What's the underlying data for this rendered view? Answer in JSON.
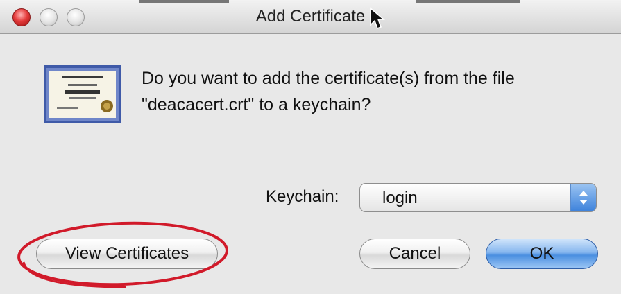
{
  "window": {
    "title": "Add Certificate"
  },
  "message": {
    "line1": "Do you want to add the certificate(s) from the file",
    "line2": "\"deacacert.crt\" to a keychain?"
  },
  "keychain": {
    "label": "Keychain:",
    "selected": "login"
  },
  "buttons": {
    "view_certificates": "View Certificates",
    "cancel": "Cancel",
    "ok": "OK"
  },
  "icons": {
    "certificate": "certificate-icon",
    "popup_arrows": "up-down-arrows-icon",
    "cursor": "mouse-pointer-icon"
  },
  "colors": {
    "close_light": "#e53c3c",
    "default_button": "#4a8fe0",
    "annotation_circle": "#d11a2a"
  }
}
